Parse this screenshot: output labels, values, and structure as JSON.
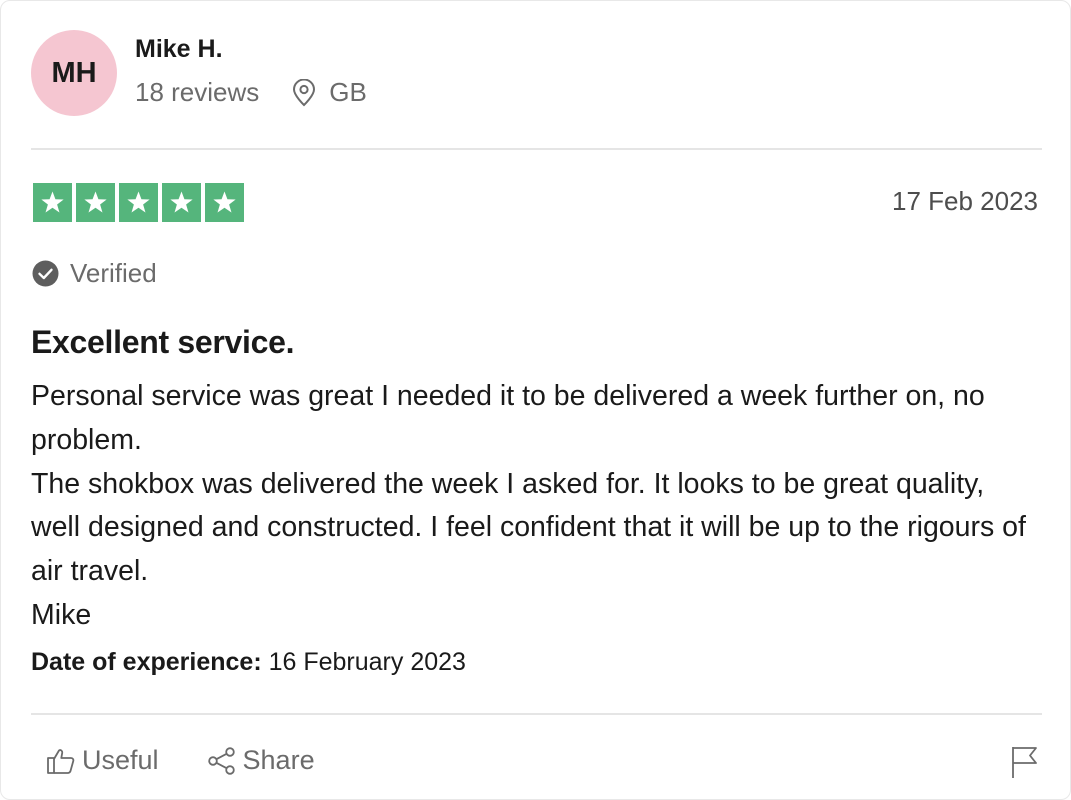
{
  "reviewer": {
    "initials": "MH",
    "name": "Mike H.",
    "reviews_count": "18 reviews",
    "location": "GB",
    "avatar_color": "#f5c6d1"
  },
  "review": {
    "rating": 5,
    "rating_max": 5,
    "star_color": "#55b57c",
    "date": "17 Feb 2023",
    "verified_label": "Verified",
    "title": "Excellent service.",
    "body_lines": [
      "Personal service was great I needed it to be delivered a week further on, no problem.",
      "The shokbox was delivered the week I asked for. It looks to be great quality, well designed and constructed. I feel confident that it will be up to the rigours of air travel.",
      "Mike"
    ],
    "experience_label": "Date of experience:",
    "experience_date": "16 February 2023"
  },
  "actions": {
    "useful_label": "Useful",
    "share_label": "Share"
  },
  "icons": {
    "location": "location-pin-icon",
    "verified": "check-circle-icon",
    "useful": "thumbs-up-icon",
    "share": "share-icon",
    "flag": "flag-icon"
  }
}
